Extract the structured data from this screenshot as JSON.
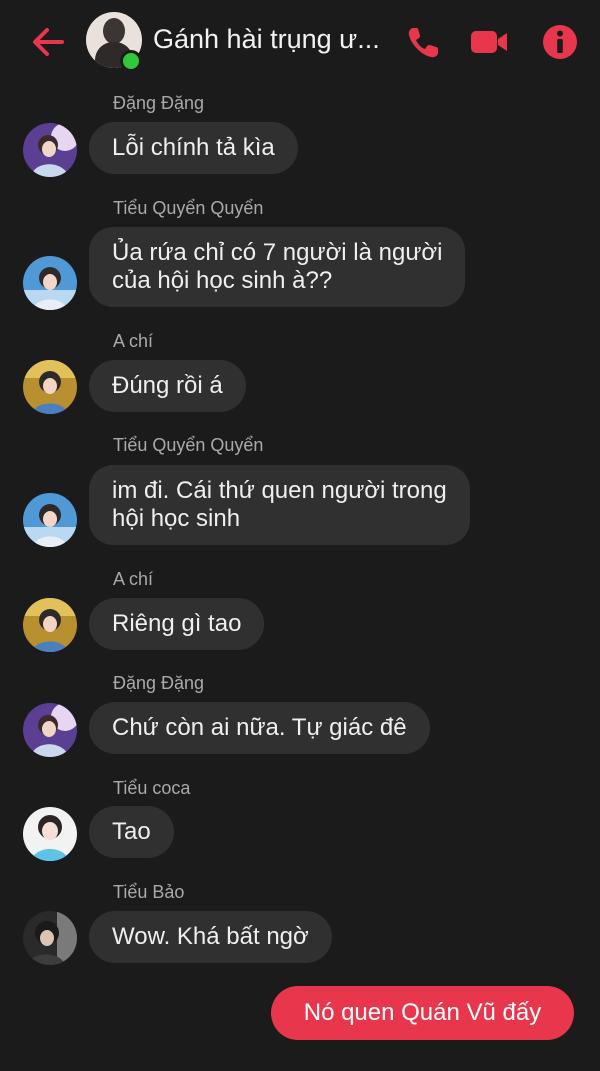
{
  "header": {
    "title": "Gánh hài trụng ư...",
    "back_icon": "back-arrow-icon",
    "call_icon": "phone-icon",
    "video_icon": "video-camera-icon",
    "info_icon": "info-icon",
    "accent_color": "#e8364d",
    "online_color": "#31c83d"
  },
  "messages": [
    {
      "sender": "Đặng Đặng",
      "lines": [
        "Lỗi chính tả kìa"
      ],
      "avatar": "avatar-purple-boy"
    },
    {
      "sender": "Tiểu Quyển Quyển",
      "lines": [
        "Ủa rứa chỉ có 7 người là người",
        "của hội học sinh à??"
      ],
      "avatar": "avatar-blue-boy"
    },
    {
      "sender": "A chí",
      "lines": [
        "Đúng rồi á"
      ],
      "avatar": "avatar-gold-boy"
    },
    {
      "sender": "Tiểu Quyển Quyển",
      "lines": [
        "im đi. Cái thứ quen người trong",
        "hội học sinh"
      ],
      "avatar": "avatar-blue-boy"
    },
    {
      "sender": "A chí",
      "lines": [
        "Riêng gì tao"
      ],
      "avatar": "avatar-gold-boy"
    },
    {
      "sender": "Đặng Đặng",
      "lines": [
        "Chứ còn ai nữa. Tự giác đê"
      ],
      "avatar": "avatar-purple-boy"
    },
    {
      "sender": "Tiểu coca",
      "lines": [
        "Tao"
      ],
      "avatar": "avatar-white-girl"
    },
    {
      "sender": "Tiểu Bảo",
      "lines": [
        "Wow. Khá bất ngờ"
      ],
      "avatar": "avatar-dark-boy"
    }
  ],
  "my_message": {
    "text": "Nó quen Quán Vũ đấy"
  }
}
